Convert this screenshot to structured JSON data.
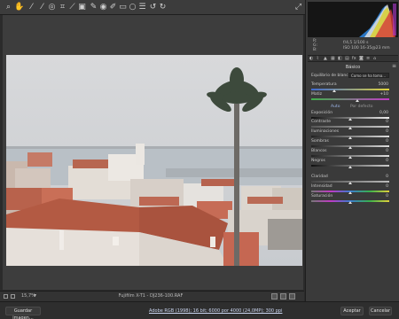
{
  "toolbar": {
    "tools": [
      "zoom-tool",
      "hand-tool",
      "white-balance-tool",
      "color-sampler-tool",
      "targeted-adjustment-tool",
      "crop-tool",
      "straighten-tool",
      "transform-tool",
      "spot-removal-tool",
      "red-eye-tool",
      "adjustment-brush-tool",
      "graduated-filter-tool",
      "radial-filter-tool",
      "preferences-tool",
      "rotate-left-tool",
      "rotate-right-tool"
    ]
  },
  "readout": {
    "rgb_labels": [
      "R:",
      "G:",
      "B:"
    ],
    "line1": "f/4,5   1/100 s",
    "line2": "ISO 100   16-35@23 mm"
  },
  "panel": {
    "section_title": "Básico",
    "wb_label": "Equilibrio de blancos:",
    "wb_value": "Como se ha toma...",
    "temperature_label": "Temperatura",
    "temperature_value": "5000",
    "tint_label": "Matiz",
    "tint_value": "+10",
    "auto_label": "Auto",
    "default_label": "Por defecto",
    "sliders": [
      {
        "label": "Exposición",
        "value": "0,00"
      },
      {
        "label": "Contraste",
        "value": "0"
      },
      {
        "label": "Iluminaciones",
        "value": "0"
      },
      {
        "label": "Sombras",
        "value": "0"
      },
      {
        "label": "Blancos",
        "value": "0"
      },
      {
        "label": "Negros",
        "value": "0"
      },
      {
        "label": "Claridad",
        "value": "0"
      },
      {
        "label": "Intensidad",
        "value": "0"
      },
      {
        "label": "Saturación",
        "value": "0"
      }
    ]
  },
  "status": {
    "zoom": "15,7%",
    "filename": "Fujifilm X-T1 - DJ236-100.RAF"
  },
  "footer": {
    "save_label": "Guardar imagen...",
    "info_link": "Adobe RGB (1998); 16 bit; 6000 por 4000 (24,0MP); 300 ppi",
    "open_label": "Aceptar",
    "cancel_label": "Cancelar"
  },
  "colors": {
    "accent": "#4d6fa8",
    "panel_bg": "#3a3a3a"
  }
}
